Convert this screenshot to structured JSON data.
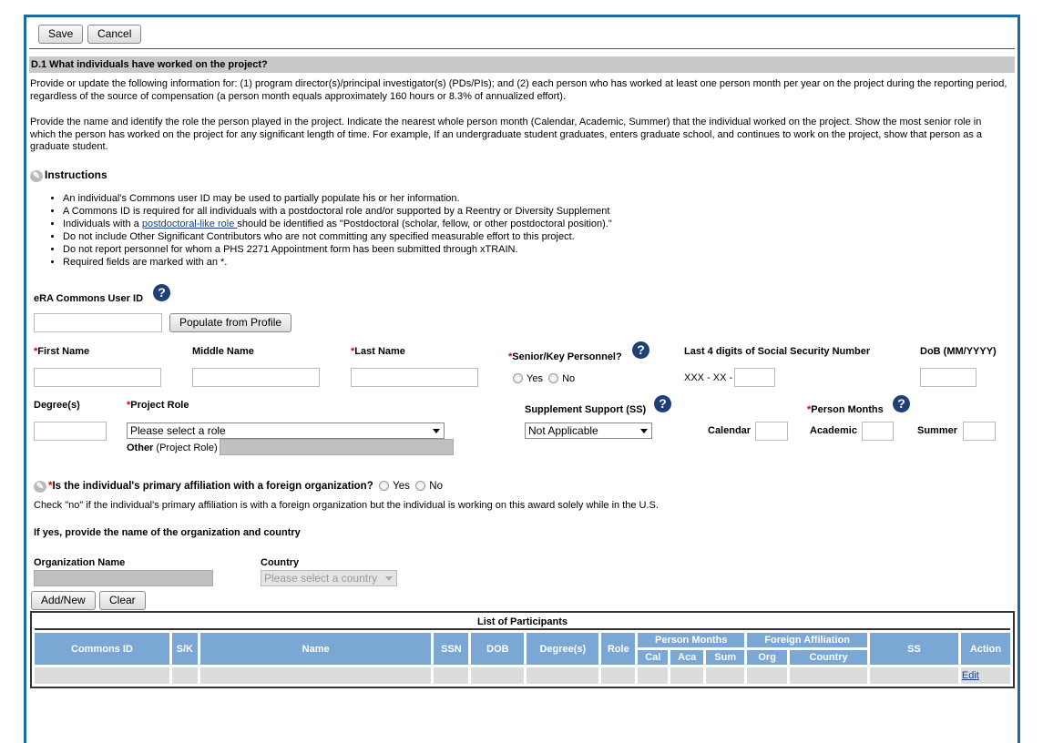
{
  "toolbar": {
    "save": "Save",
    "cancel": "Cancel"
  },
  "section": {
    "title": "D.1 What individuals have worked on the project?",
    "para1": "Provide or update the following information for: (1) program director(s)/principal investigator(s) (PDs/PIs); and (2) each person who has worked at least one person month per year on the project during the reporting period, regardless of the source of compensation (a person month equals approximately 160 hours or 8.3% of annualized effort).",
    "para2": "Provide the name and identify the role the person played in the project. Indicate the nearest whole person month (Calendar, Academic, Summer) that the individual worked on the project. Show the most senior role in which the person has worked on the project for any significant length of time. For example, If an undergraduate student graduates, enters graduate school, and continues to work on the project, show that person as a graduate student."
  },
  "instructions": {
    "title": "Instructions",
    "items": [
      "An individual's Commons user ID may be used to partially populate his or her information.",
      "A Commons ID is required for all individuals with a postdoctoral role and/or supported by a Reentry or Diversity Supplement"
    ],
    "item3_pre": "Individuals with a ",
    "item3_link": "postdoctoral-like role ",
    "item3_post": "should be identified as \"Postdoctoral (scholar, fellow, or other postdoctoral position).\"",
    "items_rest": [
      "Do not include Other Significant Contributors who are not committing any specified measurable effort to this project.",
      "Do not report personnel for whom a PHS 2271 Appointment form has been submitted through xTRAIN.",
      "Required fields are marked with an *."
    ]
  },
  "form": {
    "commons_id": "eRA Commons User ID",
    "populate": "Populate from Profile",
    "first": "First Name",
    "middle": "Middle Name",
    "last": "Last Name",
    "senior": "Senior/Key Personnel?",
    "yes": "Yes",
    "no": "No",
    "ssn": "Last 4 digits of Social Security Number",
    "ssn_prefix": "XXX - XX -",
    "dob": "DoB (MM/YYYY)",
    "degrees": "Degree(s)",
    "role": "Project Role",
    "role_value": "Please select a role",
    "other": "Other",
    "other_sub": "(Project Role)",
    "ss": "Supplement Support (SS)",
    "ss_value": "Not Applicable",
    "pm": "Person Months",
    "calendar": "Calendar",
    "academic": "Academic",
    "summer": "Summer",
    "required_mark": "*",
    "help": "?"
  },
  "foreign": {
    "question": "Is the individual's primary affiliation with a foreign organization?",
    "yes": "Yes",
    "no": "No",
    "note": "Check \"no\" if the individual's primary affiliation is with a foreign organization but the individual is working on this award solely while in the U.S.",
    "ifyes": "If yes, provide the name of the organization and country",
    "org": "Organization Name",
    "country": "Country",
    "country_placeholder": "Please select a country",
    "add": "Add/New",
    "clear": "Clear"
  },
  "table": {
    "title": "List of Participants",
    "cols": [
      "Commons ID",
      "S/K",
      "Name",
      "SSN",
      "DOB",
      "Degree(s)",
      "Role",
      "Person Months",
      "Foreign Affiliation",
      "SS",
      "Action"
    ],
    "sub": [
      "Cal",
      "Aca",
      "Sum",
      "Org",
      "Country"
    ],
    "action": "Edit"
  }
}
